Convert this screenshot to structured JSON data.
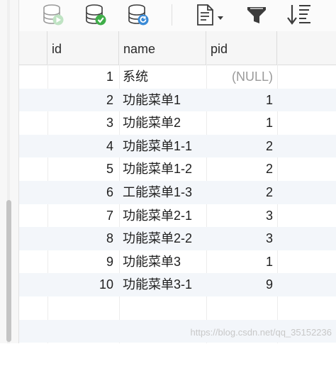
{
  "toolbar": {
    "icons": [
      "database-run-icon",
      "database-check-icon",
      "database-refresh-icon",
      "document-dropdown-icon",
      "filter-icon",
      "sort-icon"
    ]
  },
  "table": {
    "columns": [
      "id",
      "name",
      "pid"
    ],
    "rows": [
      {
        "id": "1",
        "name": "系统",
        "pid": "(NULL)"
      },
      {
        "id": "2",
        "name": "功能菜单1",
        "pid": "1"
      },
      {
        "id": "3",
        "name": "功能菜单2",
        "pid": "1"
      },
      {
        "id": "4",
        "name": "功能菜单1-1",
        "pid": "2"
      },
      {
        "id": "5",
        "name": "功能菜单1-2",
        "pid": "2"
      },
      {
        "id": "6",
        "name": "工能菜单1-3",
        "pid": "2"
      },
      {
        "id": "7",
        "name": "功能菜单2-1",
        "pid": "3"
      },
      {
        "id": "8",
        "name": "功能菜单2-2",
        "pid": "3"
      },
      {
        "id": "9",
        "name": "功能菜单3",
        "pid": "1"
      },
      {
        "id": "10",
        "name": "功能菜单3-1",
        "pid": "9"
      }
    ]
  },
  "watermark": "https://blog.csdn.net/qq_35152236",
  "colors": {
    "accent_green": "#3fae49",
    "accent_blue": "#3a8ad6",
    "row_stripe": "#f3f6fa"
  }
}
